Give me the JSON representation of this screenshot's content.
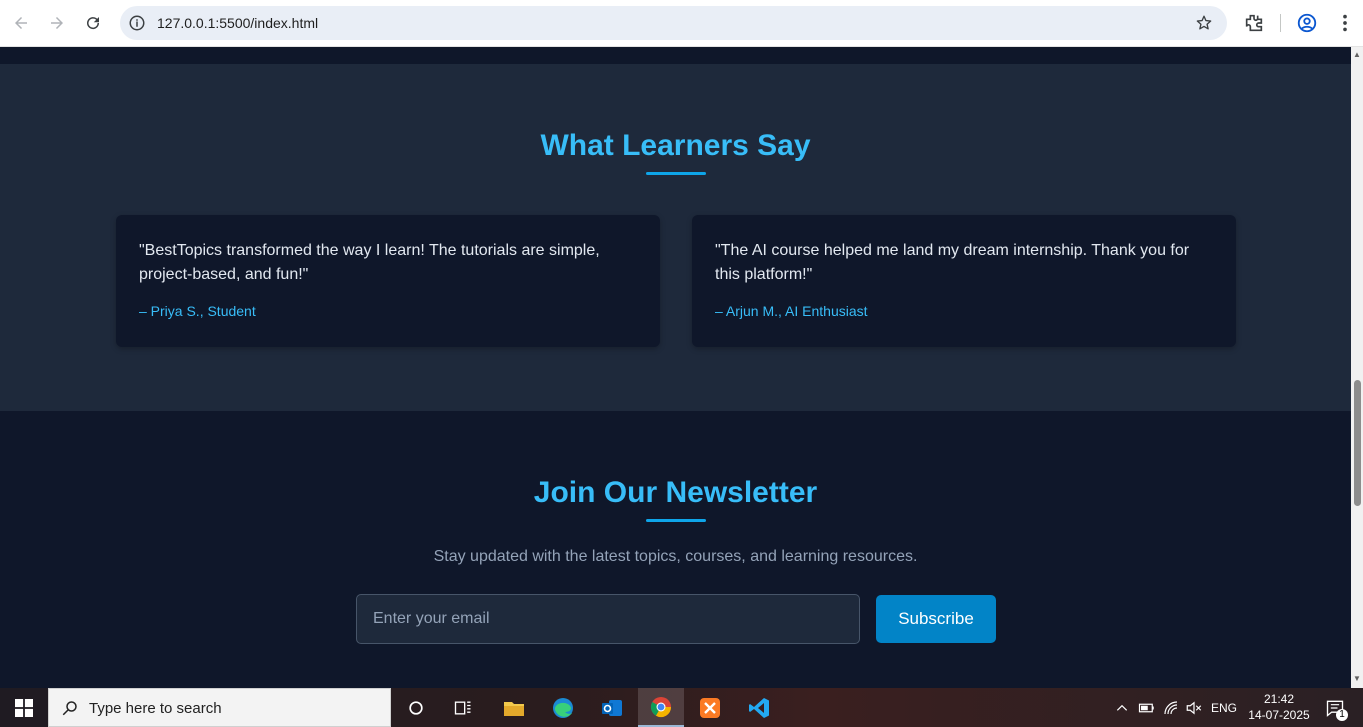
{
  "browser": {
    "url": "127.0.0.1:5500/index.html"
  },
  "testimonials": {
    "title": "What Learners Say",
    "cards": [
      {
        "quote": "\"BestTopics transformed the way I learn! The tutorials are simple, project-based, and fun!\"",
        "author": "– Priya S., Student"
      },
      {
        "quote": "\"The AI course helped me land my dream internship. Thank you for this platform!\"",
        "author": "– Arjun M., AI Enthusiast"
      }
    ]
  },
  "newsletter": {
    "title": "Join Our Newsletter",
    "subtitle": "Stay updated with the latest topics, courses, and learning resources.",
    "email_placeholder": "Enter your email",
    "subscribe_label": "Subscribe"
  },
  "taskbar": {
    "search_placeholder": "Type here to search",
    "language": "ENG",
    "time": "21:42",
    "date": "14-07-2025",
    "notification_count": "1"
  },
  "colors": {
    "accent": "#38bdf8",
    "section_bg": "#1e293b",
    "page_bg": "#0f172a",
    "button": "#0284c7"
  }
}
